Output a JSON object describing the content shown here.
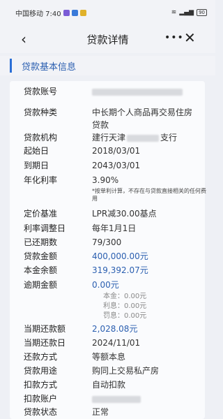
{
  "status_bar": {
    "carrier": "中国移动 7:40",
    "battery": "90"
  },
  "nav": {
    "back": "‹",
    "title": "贷款详情",
    "more": "•••",
    "close": "✕"
  },
  "section": {
    "title": "贷款基本信息"
  },
  "fields": {
    "account": {
      "label": "贷款账号"
    },
    "type": {
      "label": "贷款种类",
      "value": "中长期个人商品再交易住房贷款"
    },
    "org": {
      "label": "贷款机构",
      "value_prefix": "建行天津",
      "value_suffix": "支行"
    },
    "start": {
      "label": "起始日",
      "value": "2018/03/01"
    },
    "end": {
      "label": "到期日",
      "value": "2043/03/01"
    },
    "rate": {
      "label": "年化利率",
      "value": "3.90%",
      "note": "*按单利计算，不存在与贷款直接相关的任何费用"
    },
    "pricing": {
      "label": "定价基准",
      "value": "LPR减30.00基点"
    },
    "adjust_day": {
      "label": "利率调整日",
      "value": "每年1月1日"
    },
    "periods": {
      "label": "已还期数",
      "value": "79/300"
    },
    "amount": {
      "label": "贷款金额",
      "value": "400,000.00元"
    },
    "balance": {
      "label": "本金余额",
      "value": "319,392.07元"
    },
    "overdue": {
      "label": "逾期金额",
      "value": "0.00元",
      "principal": "本金：0.00元",
      "interest": "利息：0.00元",
      "penalty": "罚息：0.00元"
    },
    "due_amount": {
      "label": "当期还款额",
      "value": "2,028.08元"
    },
    "due_date": {
      "label": "当期还款日",
      "value": "2024/11/01"
    },
    "method": {
      "label": "还款方式",
      "value": "等额本息"
    },
    "purpose": {
      "label": "贷款用途",
      "value": "购同上交易私产房"
    },
    "deduct_way": {
      "label": "扣款方式",
      "value": "自动扣款"
    },
    "deduct_acct": {
      "label": "扣款账户"
    },
    "status": {
      "label": "贷款状态",
      "value": "正常"
    }
  },
  "colors": {
    "accent": "#2b6fd6",
    "link": "#2b5fb0",
    "bg": "#eef0f5"
  }
}
